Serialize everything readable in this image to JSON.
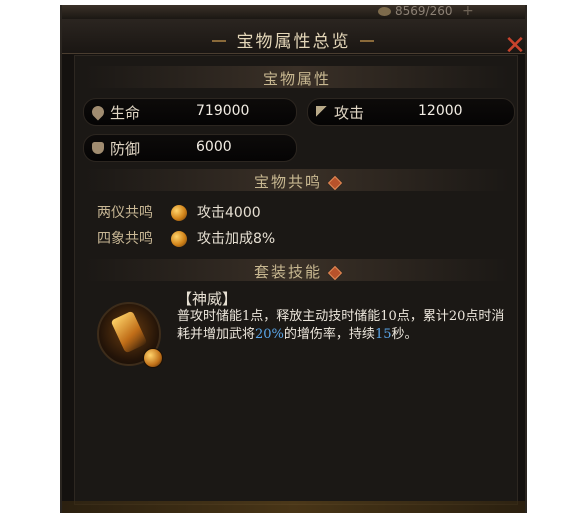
{
  "topbar": {
    "currency_value": "8569/260",
    "plus_symbol": "+"
  },
  "window": {
    "title": "宝物属性总览",
    "close_symbol": "✕"
  },
  "attributes": {
    "section_title": "宝物属性",
    "stats": [
      {
        "name": "生命",
        "value": "719000",
        "icon": "heart-icon"
      },
      {
        "name": "攻击",
        "value": "12000",
        "icon": "sword-icon"
      },
      {
        "name": "防御",
        "value": "6000",
        "icon": "shield-icon"
      }
    ]
  },
  "resonance": {
    "section_title": "宝物共鸣",
    "items": [
      {
        "label": "两仪共鸣",
        "effect": "攻击4000"
      },
      {
        "label": "四象共鸣",
        "effect": "攻击加成8%"
      }
    ]
  },
  "set_skill": {
    "section_title": "套装技能",
    "name": "【神威】",
    "desc_part1": "普攻时储能1点，释放主动技时储能10点，累计20点时消耗并增加武将",
    "desc_highlight1": "20%",
    "desc_part2": "的增伤率，持续",
    "desc_highlight2": "15",
    "desc_part3": "秒。"
  },
  "colors": {
    "highlight": "#5aa4e6",
    "close": "#c8432c",
    "section_text": "#c8b891"
  }
}
